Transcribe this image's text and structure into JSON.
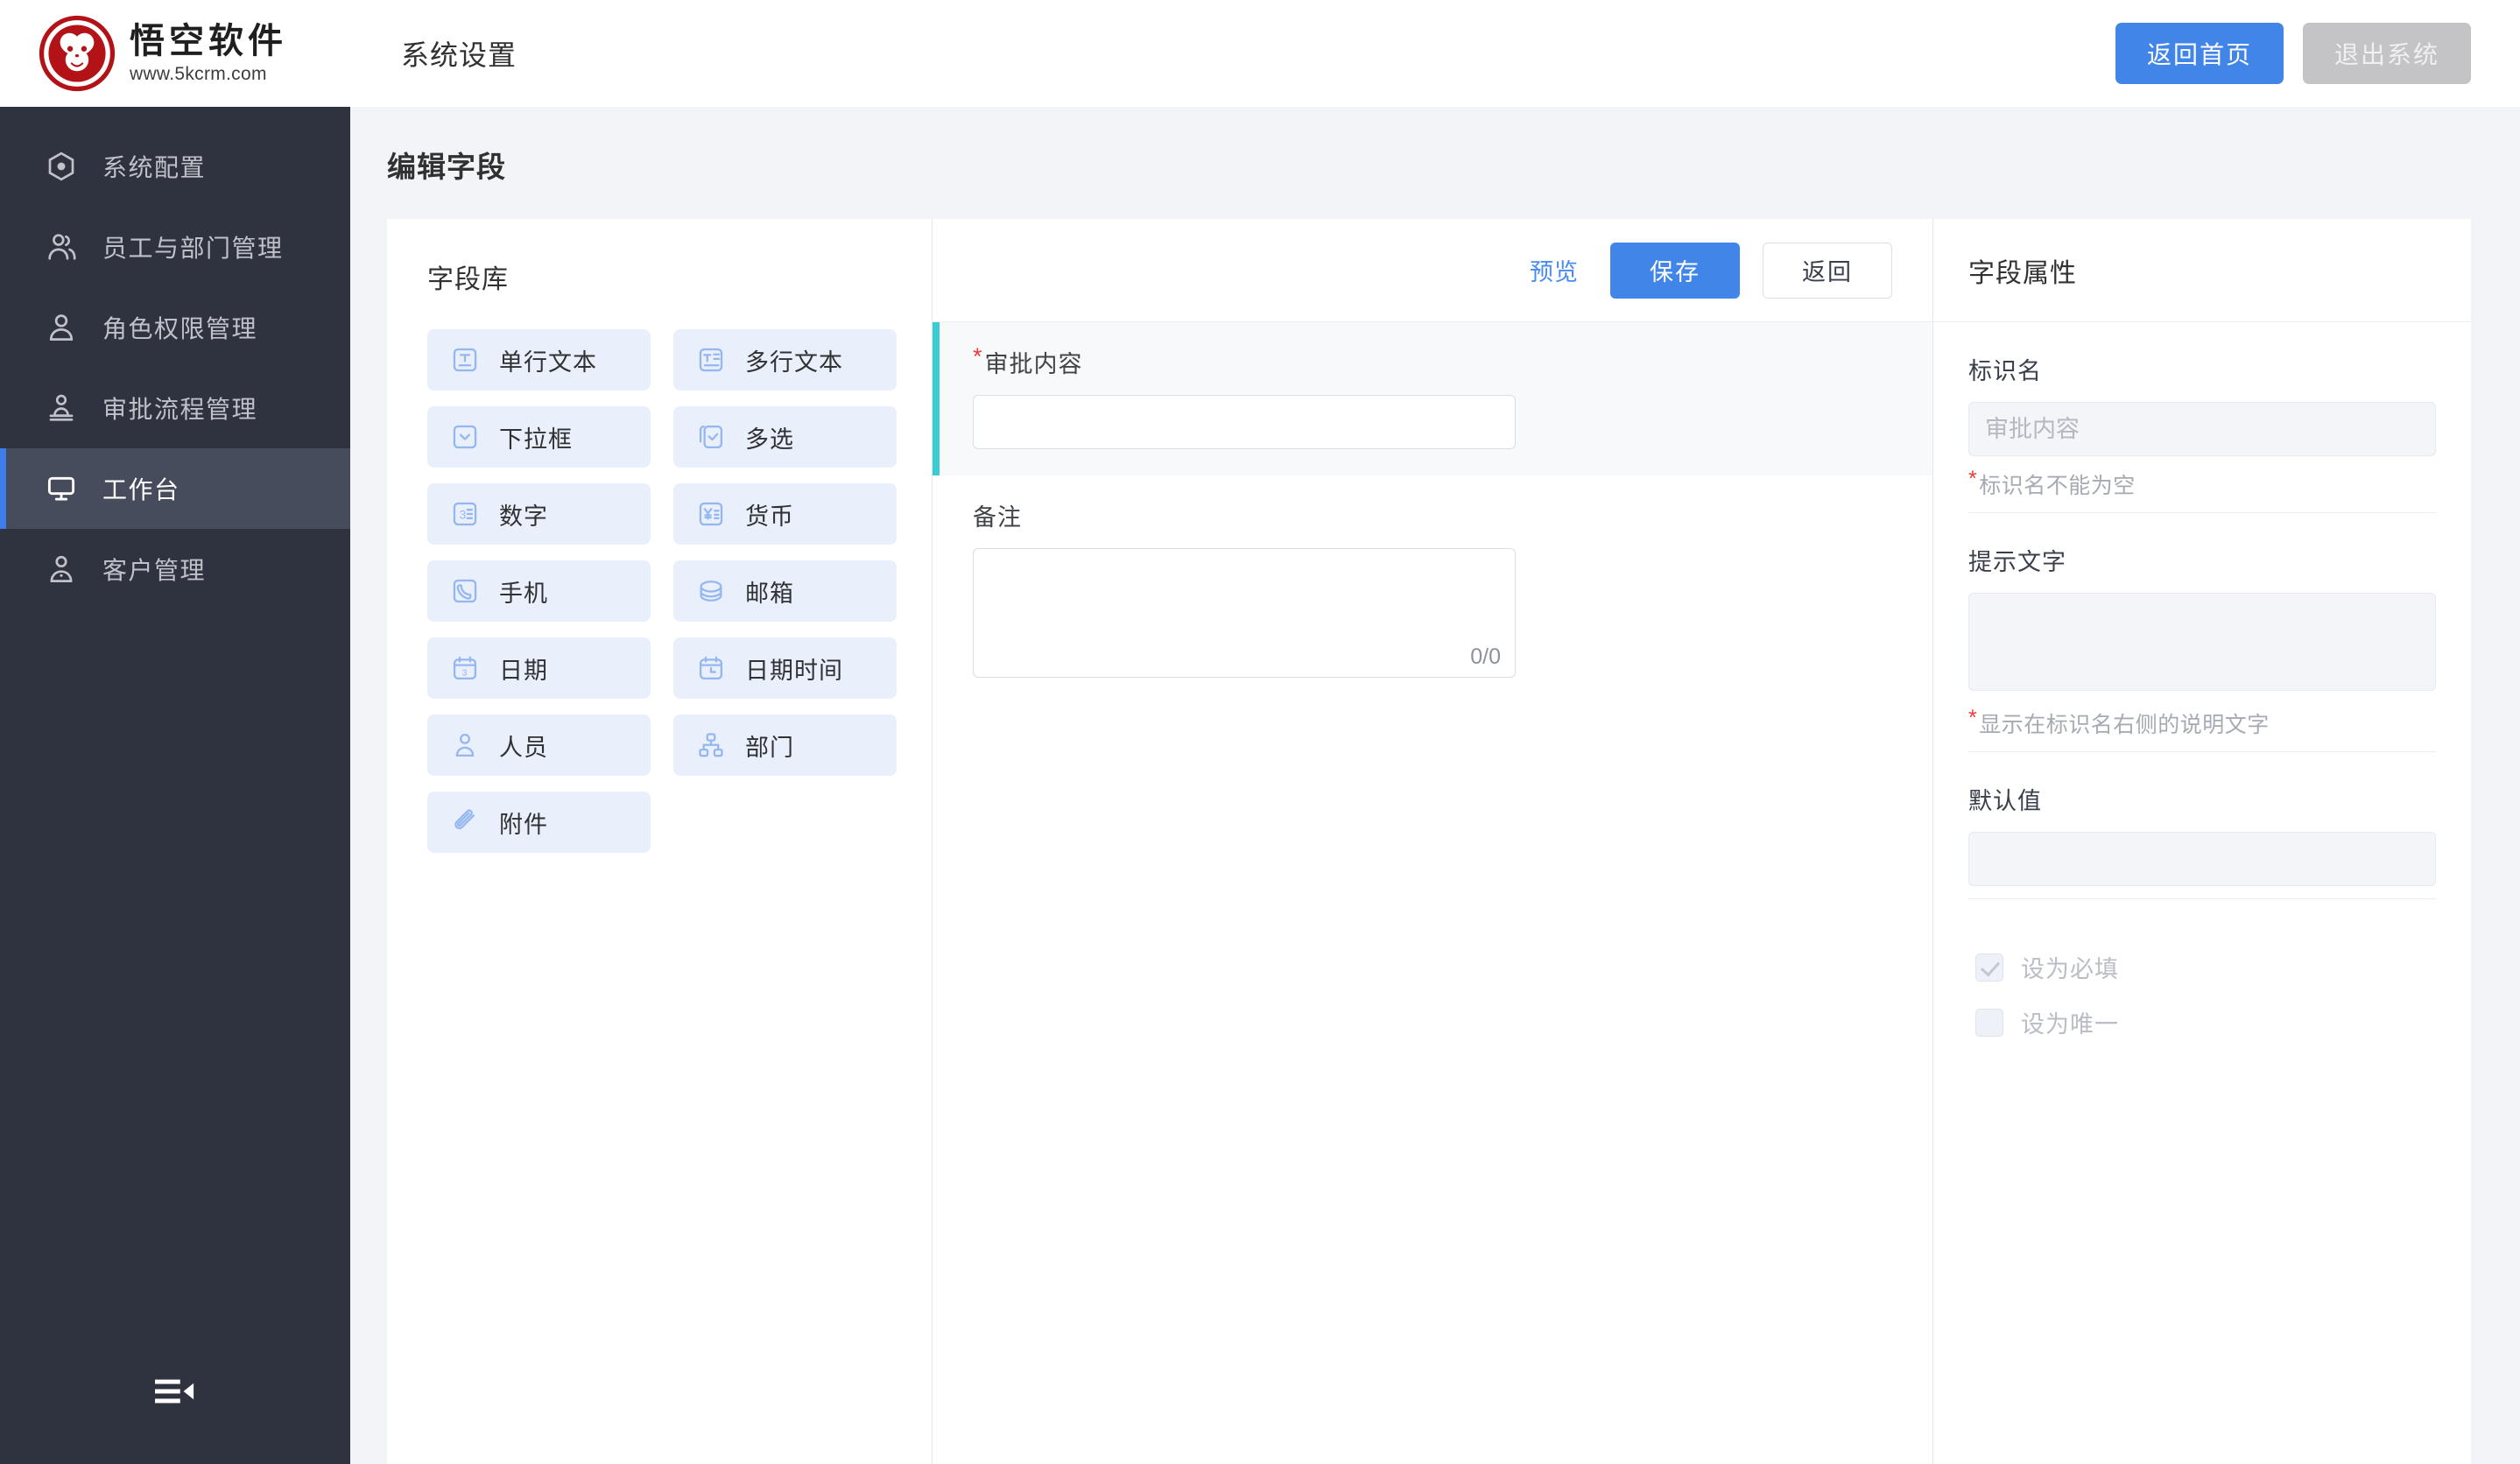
{
  "brand": {
    "name_cn": "悟空软件",
    "url": "www.5kcrm.com",
    "logo_icon": "monkey-logo"
  },
  "header": {
    "title": "系统设置",
    "home_button": "返回首页",
    "logout_button": "退出系统"
  },
  "sidebar": {
    "items": [
      {
        "label": "系统配置",
        "icon": "hexagon-gear-icon",
        "active": false
      },
      {
        "label": "员工与部门管理",
        "icon": "users-group-icon",
        "active": false
      },
      {
        "label": "角色权限管理",
        "icon": "user-role-icon",
        "active": false
      },
      {
        "label": "审批流程管理",
        "icon": "approval-stamp-icon",
        "active": false
      },
      {
        "label": "工作台",
        "icon": "monitor-icon",
        "active": true
      },
      {
        "label": "客户管理",
        "icon": "customer-icon",
        "active": false
      }
    ],
    "collapse_icon": "menu-fold-icon"
  },
  "page": {
    "title": "编辑字段"
  },
  "field_library": {
    "title": "字段库",
    "items": [
      {
        "label": "单行文本",
        "icon": "single-line-text-icon"
      },
      {
        "label": "多行文本",
        "icon": "multi-line-text-icon"
      },
      {
        "label": "下拉框",
        "icon": "dropdown-icon"
      },
      {
        "label": "多选",
        "icon": "multi-select-icon"
      },
      {
        "label": "数字",
        "icon": "number-icon"
      },
      {
        "label": "货币",
        "icon": "currency-icon"
      },
      {
        "label": "手机",
        "icon": "phone-icon"
      },
      {
        "label": "邮箱",
        "icon": "email-icon"
      },
      {
        "label": "日期",
        "icon": "date-icon"
      },
      {
        "label": "日期时间",
        "icon": "datetime-icon"
      },
      {
        "label": "人员",
        "icon": "person-icon"
      },
      {
        "label": "部门",
        "icon": "department-icon"
      },
      {
        "label": "附件",
        "icon": "attachment-icon"
      }
    ]
  },
  "form": {
    "toolbar": {
      "preview": "预览",
      "save": "保存",
      "back": "返回"
    },
    "fields": [
      {
        "label": "审批内容",
        "required": true,
        "type": "single-line-text",
        "value": "",
        "selected": true
      },
      {
        "label": "备注",
        "required": false,
        "type": "multi-line-text",
        "value": "",
        "counter": "0/0",
        "selected": false
      }
    ]
  },
  "properties": {
    "title": "字段属性",
    "ident_name": {
      "label": "标识名",
      "value": "",
      "placeholder": "审批内容",
      "hint": "标识名不能为空",
      "hint_star": "*"
    },
    "hint_text": {
      "label": "提示文字",
      "value": "",
      "placeholder": "",
      "hint": "显示在标识名右侧的说明文字",
      "hint_star": "*"
    },
    "default_value": {
      "label": "默认值",
      "value": "",
      "placeholder": ""
    },
    "checkboxes": [
      {
        "label": "设为必填",
        "checked": true
      },
      {
        "label": "设为唯一",
        "checked": false
      }
    ]
  },
  "colors": {
    "primary": "#4285e9",
    "sidebar_bg": "#2f333f",
    "sidebar_active_bg": "#464c5b",
    "sidebar_active_border": "#3c7dea",
    "selected_field_accent": "#3bcbd4",
    "chip_bg": "#e9effb",
    "chip_icon": "#94b7f0",
    "required_star": "#f03b36",
    "logo_red": "#b31217",
    "page_bg": "#f2f4f8"
  }
}
